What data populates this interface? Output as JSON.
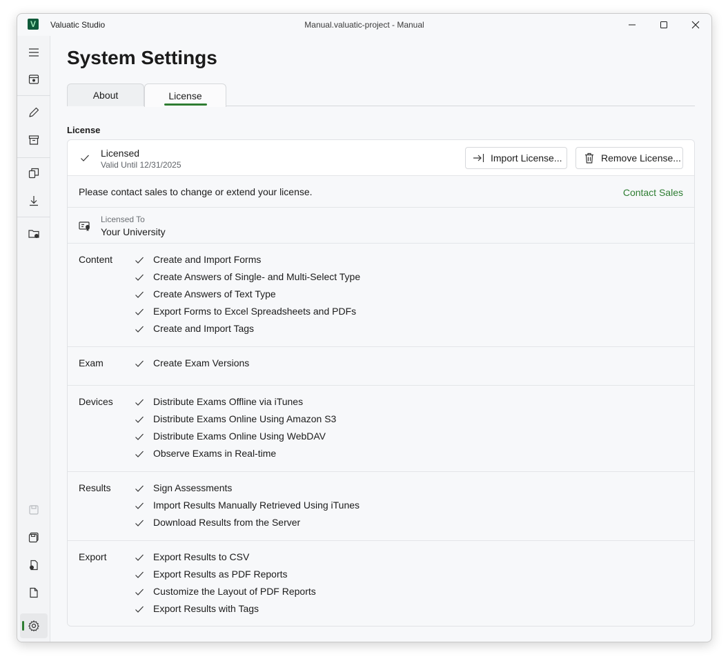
{
  "window": {
    "app_name": "Valuatic Studio",
    "app_logo_letter": "V",
    "document_title": "Manual.valuatic-project - Manual"
  },
  "rail": {
    "icons": [
      "hamburger-menu-icon",
      "project-box-icon",
      "edit-pencil-icon",
      "archive-icon",
      "copy-pages-icon",
      "download-icon",
      "folder-sync-icon",
      "save-disabled-icon",
      "save-as-icon",
      "export-doc-icon",
      "new-file-icon",
      "settings-gear-icon"
    ]
  },
  "page": {
    "title": "System Settings",
    "tabs": [
      {
        "label": "About"
      },
      {
        "label": "License"
      }
    ],
    "section_label": "License"
  },
  "license": {
    "status": "Licensed",
    "valid_until": "Valid Until 12/31/2025",
    "import_button": "Import License...",
    "remove_button": "Remove License...",
    "contact_text": "Please contact sales to change or extend your license.",
    "contact_link": "Contact Sales",
    "licensed_to_label": "Licensed To",
    "licensed_to_value": "Your University"
  },
  "features": [
    {
      "category": "Content",
      "items": [
        "Create and Import Forms",
        "Create Answers of Single- and Multi-Select Type",
        "Create Answers of Text Type",
        "Export Forms to Excel Spreadsheets and PDFs",
        "Create and Import Tags"
      ]
    },
    {
      "category": "Exam",
      "items": [
        "Create Exam Versions"
      ]
    },
    {
      "category": "Devices",
      "items": [
        "Distribute Exams Offline via iTunes",
        "Distribute Exams Online Using Amazon S3",
        "Distribute Exams Online Using WebDAV",
        "Observe Exams in Real-time"
      ]
    },
    {
      "category": "Results",
      "items": [
        "Sign Assessments",
        "Import Results Manually Retrieved Using iTunes",
        "Download Results from the Server"
      ]
    },
    {
      "category": "Export",
      "items": [
        "Export Results to CSV",
        "Export Results as PDF Reports",
        "Customize the Layout of PDF Reports",
        "Export Results with Tags"
      ]
    }
  ],
  "colors": {
    "accent": "#2e7d32",
    "link": "#2e7d32"
  }
}
